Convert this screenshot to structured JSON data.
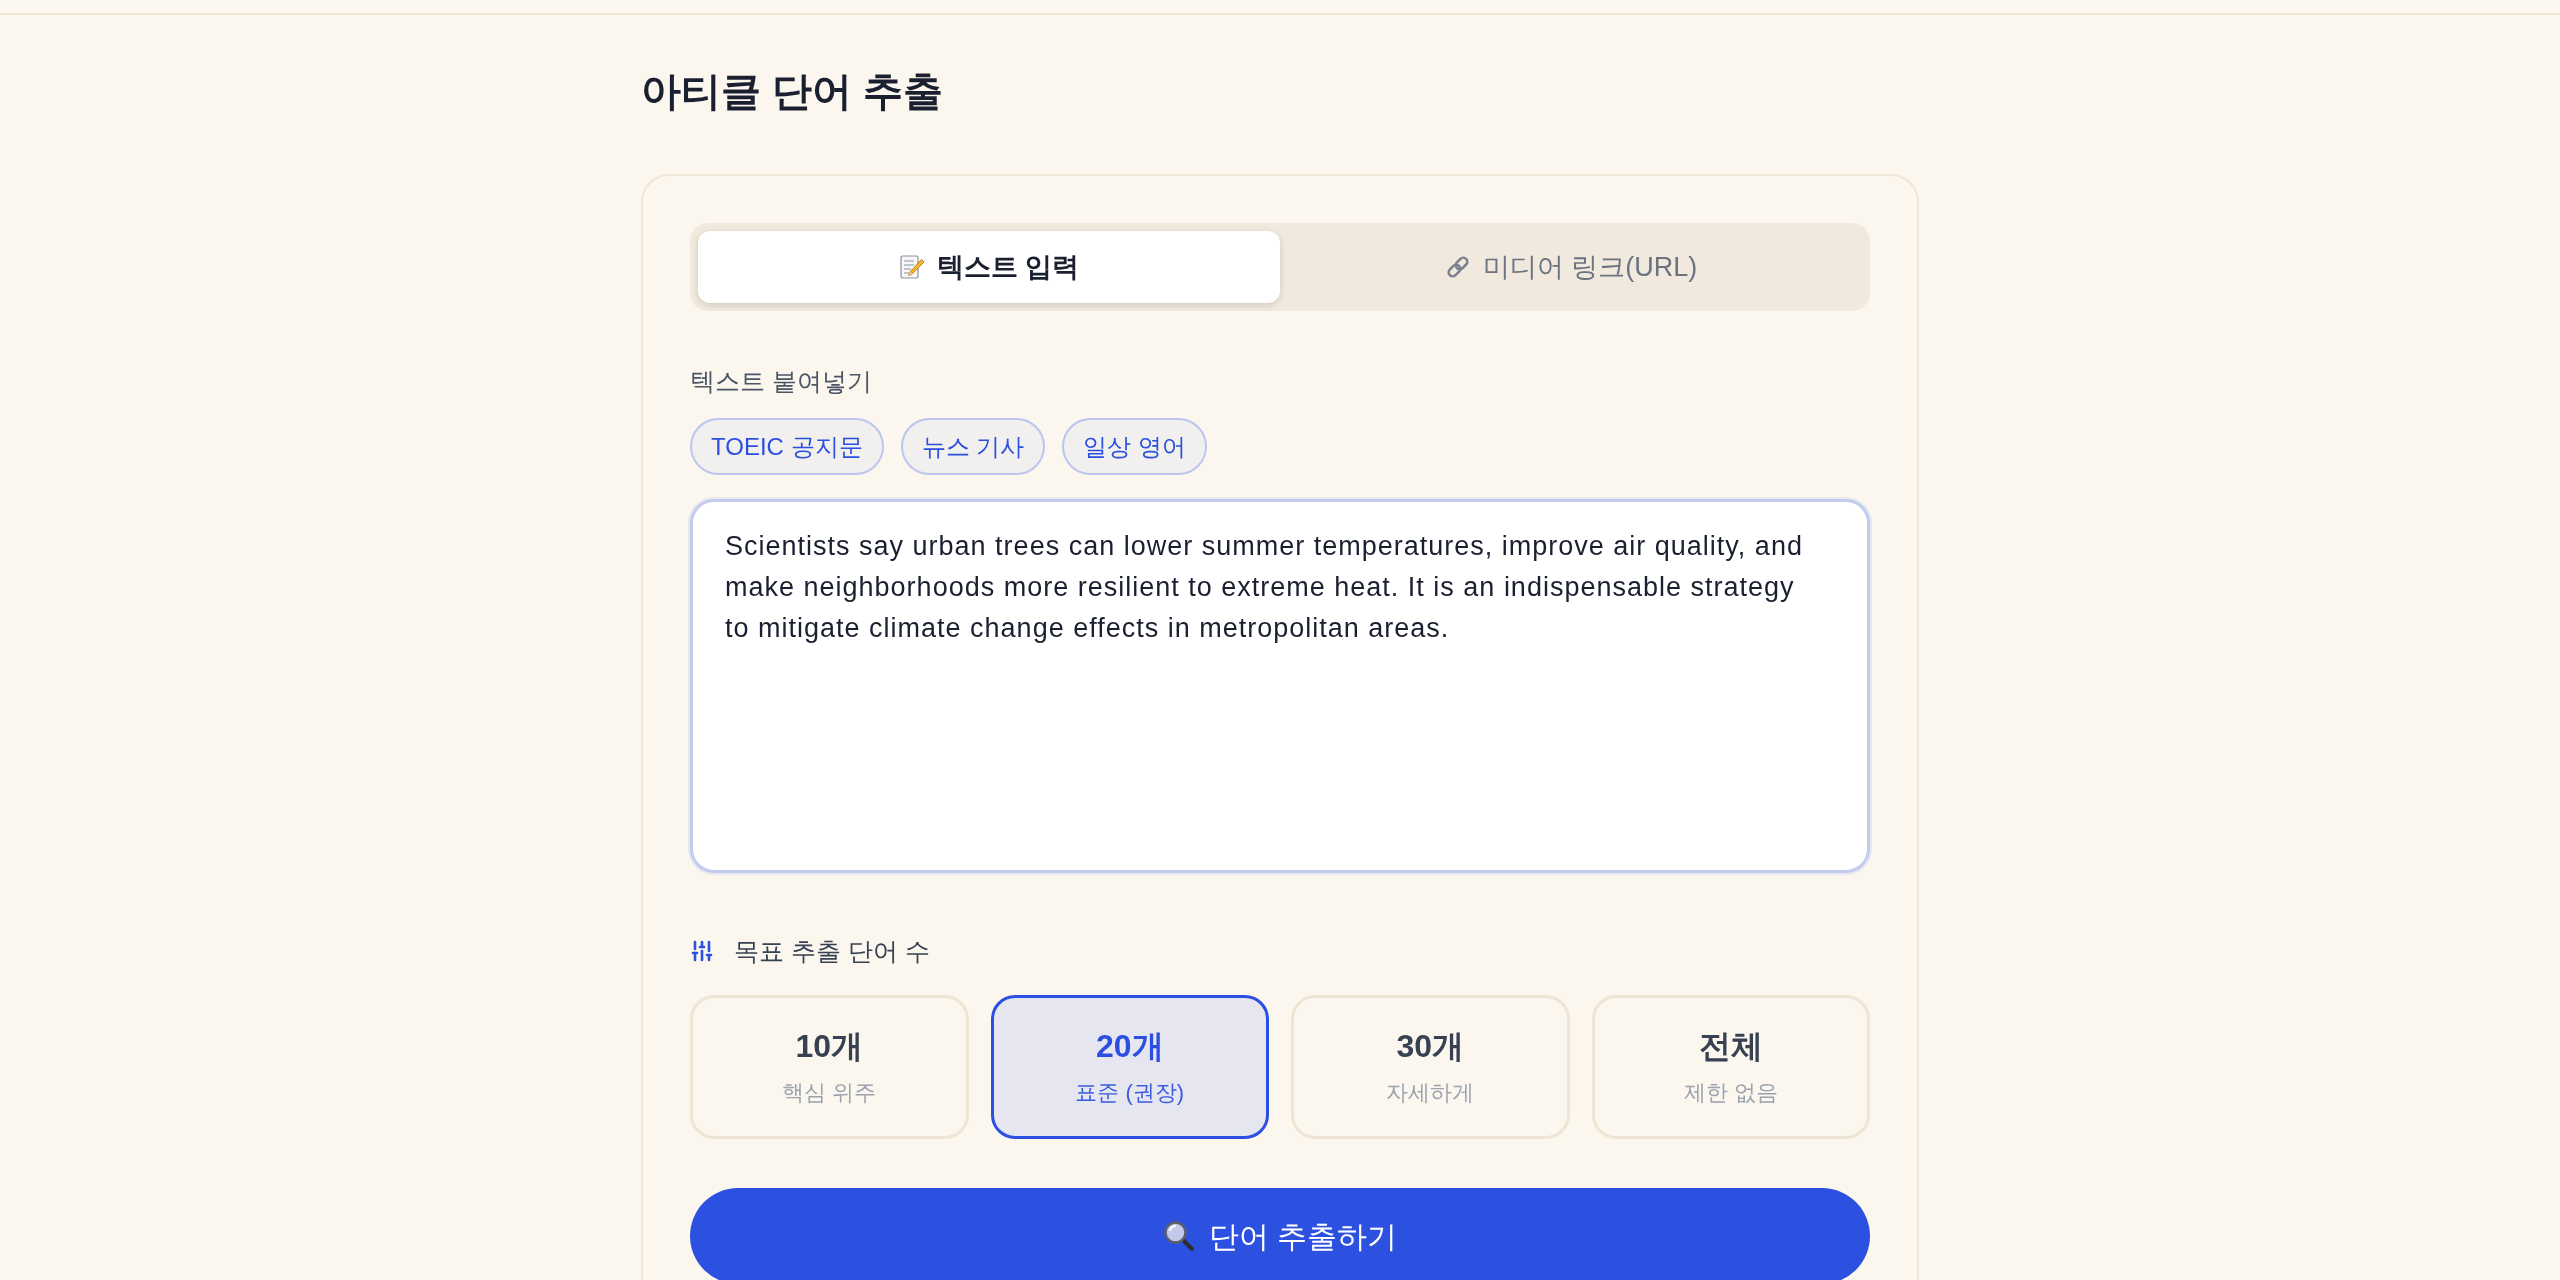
{
  "page": {
    "title": "아티클 단어 추출"
  },
  "tabs": [
    {
      "kind": "text",
      "label": "텍스트 입력",
      "selected": true
    },
    {
      "kind": "link",
      "label": "미디어 링크(URL)",
      "selected": false
    }
  ],
  "paste_section": {
    "label": "텍스트 붙여넣기",
    "samples": [
      "TOEIC 공지문",
      "뉴스 기사",
      "일상 영어"
    ],
    "text_field": {
      "value": "Scientists say urban trees can lower summer temperatures, improve air quality, and make neighborhoods more resilient to extreme heat. It is an indispensable strategy to mitigate climate change effects in metropolitan areas."
    }
  },
  "word_count": {
    "label": "목표 추출 단어 수",
    "options": [
      {
        "count": "10개",
        "caption": "핵심 위주",
        "selected": false
      },
      {
        "count": "20개",
        "caption": "표준 (권장)",
        "selected": true
      },
      {
        "count": "30개",
        "caption": "자세하게",
        "selected": false
      },
      {
        "count": "전체",
        "caption": "제한 없음",
        "selected": false
      }
    ]
  },
  "extract_button": {
    "label": "단어 추출하기"
  }
}
